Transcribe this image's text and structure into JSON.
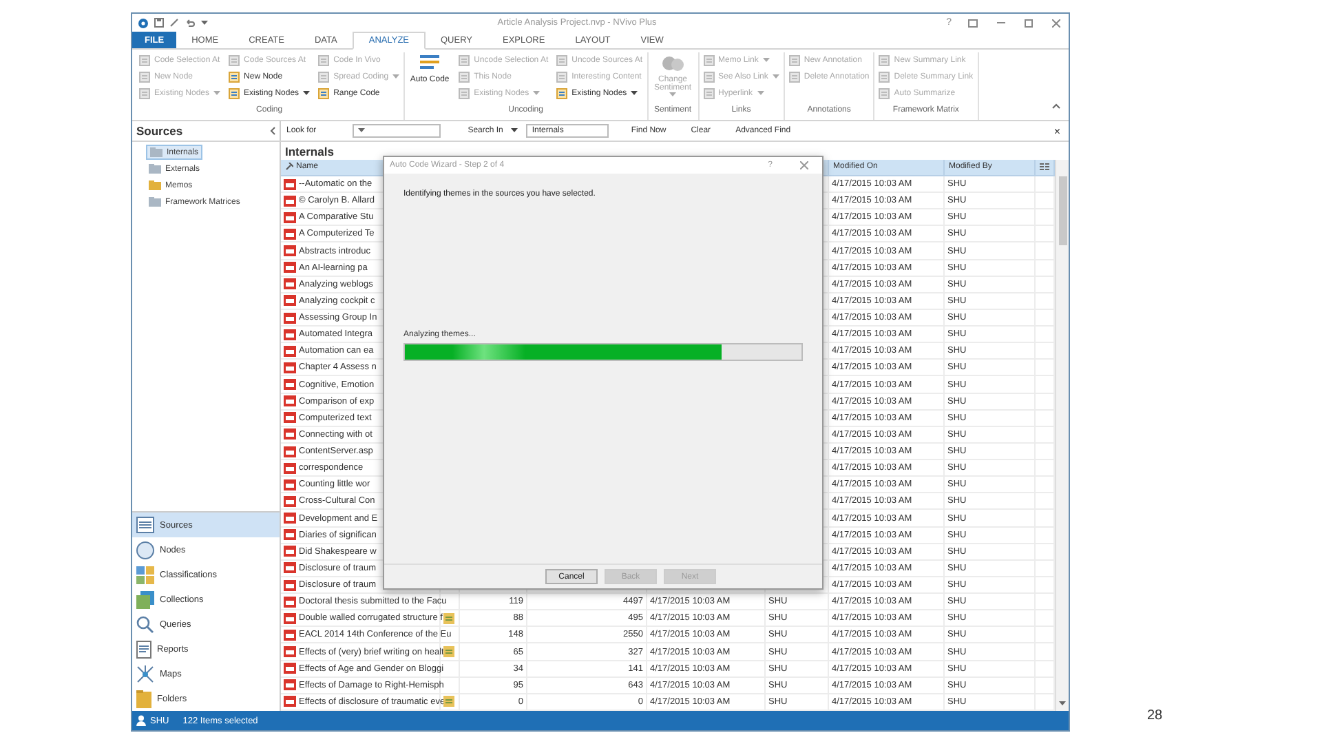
{
  "window": {
    "title": "Article Analysis Project.nvp - NVivo Plus",
    "help": "?"
  },
  "ribbon_tabs": [
    {
      "label": "FILE",
      "kind": "file",
      "selected": false
    },
    {
      "label": "HOME",
      "kind": "tab",
      "selected": false
    },
    {
      "label": "CREATE",
      "kind": "tab",
      "selected": false
    },
    {
      "label": "DATA",
      "kind": "tab",
      "selected": false
    },
    {
      "label": "ANALYZE",
      "kind": "tab",
      "selected": true
    },
    {
      "label": "QUERY",
      "kind": "tab",
      "selected": false
    },
    {
      "label": "EXPLORE",
      "kind": "tab",
      "selected": false
    },
    {
      "label": "LAYOUT",
      "kind": "tab",
      "selected": false
    },
    {
      "label": "VIEW",
      "kind": "tab",
      "selected": false
    }
  ],
  "ribbon": {
    "groups": [
      {
        "label": "Coding",
        "columns": [
          [
            {
              "label": "Code Selection At",
              "kind": "small",
              "disabled": true
            },
            {
              "label": "New Node",
              "kind": "small",
              "disabled": true
            },
            {
              "label": "Existing Nodes",
              "kind": "small",
              "disabled": true,
              "menu": true
            }
          ],
          [
            {
              "label": "Code Sources At",
              "kind": "small",
              "disabled": true
            },
            {
              "label": "New Node",
              "kind": "small",
              "disabled": false
            },
            {
              "label": "Existing Nodes",
              "kind": "small",
              "disabled": false,
              "menu": true
            }
          ],
          [
            {
              "label": "Code In Vivo",
              "kind": "small",
              "disabled": true
            },
            {
              "label": "Spread Coding",
              "kind": "small",
              "disabled": true,
              "menu": true
            },
            {
              "label": "Range Code",
              "kind": "small",
              "disabled": false
            }
          ]
        ]
      },
      {
        "label": "Uncoding",
        "columns": [
          [
            {
              "label": "Auto Code",
              "kind": "large",
              "disabled": false
            }
          ],
          [
            {
              "label": "Uncode Selection At",
              "kind": "small",
              "disabled": true
            },
            {
              "label": "This Node",
              "kind": "small",
              "disabled": true
            },
            {
              "label": "Existing Nodes",
              "kind": "small",
              "disabled": true,
              "menu": true
            }
          ],
          [
            {
              "label": "Uncode Sources At",
              "kind": "small",
              "disabled": true
            },
            {
              "label": "Interesting Content",
              "kind": "small",
              "disabled": true
            },
            {
              "label": "Existing Nodes",
              "kind": "small",
              "disabled": false,
              "menu": true
            }
          ]
        ]
      },
      {
        "label": "Sentiment",
        "columns": [
          [
            {
              "label": "Change Sentiment",
              "kind": "large",
              "disabled": true,
              "menu": true
            }
          ]
        ]
      },
      {
        "label": "Links",
        "columns": [
          [
            {
              "label": "Memo Link",
              "kind": "small",
              "disabled": true,
              "menu": true
            },
            {
              "label": "See Also Link",
              "kind": "small",
              "disabled": true,
              "menu": true
            },
            {
              "label": "Hyperlink",
              "kind": "small",
              "disabled": true,
              "menu": true
            }
          ]
        ]
      },
      {
        "label": "Annotations",
        "columns": [
          [
            {
              "label": "New Annotation",
              "kind": "small",
              "disabled": true
            },
            {
              "label": "Delete Annotation",
              "kind": "small",
              "disabled": true
            }
          ]
        ]
      },
      {
        "label": "Framework Matrix",
        "columns": [
          [
            {
              "label": "New Summary Link",
              "kind": "small",
              "disabled": true
            },
            {
              "label": "Delete Summary Link",
              "kind": "small",
              "disabled": true
            },
            {
              "label": "Auto Summarize",
              "kind": "small",
              "disabled": true
            }
          ]
        ]
      }
    ]
  },
  "sources_panel": {
    "title": "Sources",
    "tree": [
      {
        "label": "Internals",
        "selected": true
      },
      {
        "label": "Externals",
        "selected": false
      },
      {
        "label": "Memos",
        "selected": false
      },
      {
        "label": "Framework Matrices",
        "selected": false
      }
    ]
  },
  "navigation": [
    {
      "label": "Sources",
      "selected": true
    },
    {
      "label": "Nodes",
      "selected": false
    },
    {
      "label": "Classifications",
      "selected": false
    },
    {
      "label": "Collections",
      "selected": false
    },
    {
      "label": "Queries",
      "selected": false
    },
    {
      "label": "Reports",
      "selected": false
    },
    {
      "label": "Maps",
      "selected": false
    },
    {
      "label": "Folders",
      "selected": false
    }
  ],
  "find_bar": {
    "look_for": "Look for",
    "search_in": "Search In",
    "search_in_value": "Internals",
    "find_now": "Find Now",
    "clear": "Clear",
    "advanced_find": "Advanced Find",
    "close": "×"
  },
  "table": {
    "title": "Internals",
    "columns": {
      "name": "Name",
      "modified_on": "Modified On",
      "modified_by": "Modified By"
    },
    "rows": [
      {
        "name": "--Automatic on the",
        "modified_on": "4/17/2015 10:03 AM",
        "modified_by": "SHU"
      },
      {
        "name": "© Carolyn B. Allard",
        "modified_on": "4/17/2015 10:03 AM",
        "modified_by": "SHU"
      },
      {
        "name": "A Comparative Stu",
        "modified_on": "4/17/2015 10:03 AM",
        "modified_by": "SHU"
      },
      {
        "name": "A Computerized Te",
        "modified_on": "4/17/2015 10:03 AM",
        "modified_by": "SHU"
      },
      {
        "name": "Abstracts introduc",
        "modified_on": "4/17/2015 10:03 AM",
        "modified_by": "SHU"
      },
      {
        "name": "An AI-learning pa",
        "modified_on": "4/17/2015 10:03 AM",
        "modified_by": "SHU"
      },
      {
        "name": "Analyzing weblogs",
        "modified_on": "4/17/2015 10:03 AM",
        "modified_by": "SHU"
      },
      {
        "name": "Analyzing cockpit c",
        "modified_on": "4/17/2015 10:03 AM",
        "modified_by": "SHU"
      },
      {
        "name": "Assessing Group In",
        "modified_on": "4/17/2015 10:03 AM",
        "modified_by": "SHU"
      },
      {
        "name": "Automated Integra",
        "modified_on": "4/17/2015 10:03 AM",
        "modified_by": "SHU"
      },
      {
        "name": "Automation can ea",
        "modified_on": "4/17/2015 10:03 AM",
        "modified_by": "SHU"
      },
      {
        "name": "Chapter 4 Assess n",
        "modified_on": "4/17/2015 10:03 AM",
        "modified_by": "SHU"
      },
      {
        "name": "Cognitive, Emotion",
        "modified_on": "4/17/2015 10:03 AM",
        "modified_by": "SHU"
      },
      {
        "name": "Comparison of exp",
        "modified_on": "4/17/2015 10:03 AM",
        "modified_by": "SHU"
      },
      {
        "name": "Computerized text",
        "modified_on": "4/17/2015 10:03 AM",
        "modified_by": "SHU"
      },
      {
        "name": "Connecting with ot",
        "modified_on": "4/17/2015 10:03 AM",
        "modified_by": "SHU"
      },
      {
        "name": "ContentServer.asp",
        "modified_on": "4/17/2015 10:03 AM",
        "modified_by": "SHU"
      },
      {
        "name": "correspondence",
        "modified_on": "4/17/2015 10:03 AM",
        "modified_by": "SHU"
      },
      {
        "name": "Counting little wor",
        "modified_on": "4/17/2015 10:03 AM",
        "modified_by": "SHU"
      },
      {
        "name": "Cross-Cultural Con",
        "modified_on": "4/17/2015 10:03 AM",
        "modified_by": "SHU"
      },
      {
        "name": "Development and E",
        "modified_on": "4/17/2015 10:03 AM",
        "modified_by": "SHU"
      },
      {
        "name": "Diaries of significan",
        "modified_on": "4/17/2015 10:03 AM",
        "modified_by": "SHU"
      },
      {
        "name": "Did Shakespeare w",
        "modified_on": "4/17/2015 10:03 AM",
        "modified_by": "SHU"
      },
      {
        "name": "Disclosure of traum",
        "modified_on": "4/17/2015 10:03 AM",
        "modified_by": "SHU"
      },
      {
        "name": "Disclosure of traum",
        "modified_on": "4/17/2015 10:03 AM",
        "modified_by": "SHU"
      },
      {
        "name": "Doctoral thesis submitted to the Facu",
        "memo": false,
        "nodes": "119",
        "references": "4497",
        "created_on": "4/17/2015 10:03 AM",
        "created_by": "SHU",
        "modified_on": "4/17/2015 10:03 AM",
        "modified_by": "SHU"
      },
      {
        "name": "Double walled corrugated structure f",
        "memo": true,
        "nodes": "88",
        "references": "495",
        "created_on": "4/17/2015 10:03 AM",
        "created_by": "SHU",
        "modified_on": "4/17/2015 10:03 AM",
        "modified_by": "SHU"
      },
      {
        "name": "EACL 2014 14th Conference of the Eu",
        "memo": false,
        "nodes": "148",
        "references": "2550",
        "created_on": "4/17/2015 10:03 AM",
        "created_by": "SHU",
        "modified_on": "4/17/2015 10:03 AM",
        "modified_by": "SHU"
      },
      {
        "name": "Effects of (very) brief writing on healt",
        "memo": true,
        "nodes": "65",
        "references": "327",
        "created_on": "4/17/2015 10:03 AM",
        "created_by": "SHU",
        "modified_on": "4/17/2015 10:03 AM",
        "modified_by": "SHU"
      },
      {
        "name": "Effects of Age and Gender on Bloggi",
        "memo": false,
        "nodes": "34",
        "references": "141",
        "created_on": "4/17/2015 10:03 AM",
        "created_by": "SHU",
        "modified_on": "4/17/2015 10:03 AM",
        "modified_by": "SHU"
      },
      {
        "name": "Effects of Damage to Right-Hemisph",
        "memo": false,
        "nodes": "95",
        "references": "643",
        "created_on": "4/17/2015 10:03 AM",
        "created_by": "SHU",
        "modified_on": "4/17/2015 10:03 AM",
        "modified_by": "SHU"
      },
      {
        "name": "Effects of disclosure of traumatic eve",
        "memo": true,
        "nodes": "0",
        "references": "0",
        "created_on": "4/17/2015 10:03 AM",
        "created_by": "SHU",
        "modified_on": "4/17/2015 10:03 AM",
        "modified_by": "SHU"
      }
    ]
  },
  "dialog": {
    "title": "Auto Code Wizard - Step 2 of 4",
    "help": "?",
    "message": "Identifying themes in the sources you have selected.",
    "progress_label": "Analyzing themes...",
    "level": 0.8,
    "buttons": [
      {
        "label": "Cancel",
        "disabled": false
      },
      {
        "label": "Back",
        "disabled": true
      },
      {
        "label": "Next",
        "disabled": true
      }
    ]
  },
  "status_bar": {
    "user": "SHU",
    "message": "122 Items selected"
  },
  "slide_number": "28"
}
